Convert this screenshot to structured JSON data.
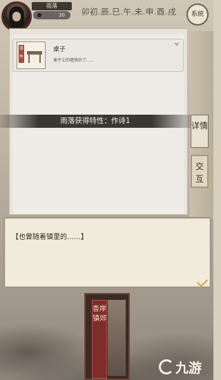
{
  "player": {
    "name": "雨落",
    "level": "20"
  },
  "time_bar": {
    "text": "卯初.辰.巳.午.未.申.酉.戌"
  },
  "system_button": {
    "label": "系统"
  },
  "event": {
    "icon_seal": "事件",
    "title": "桌子",
    "description": "桌子上的墙快好了……"
  },
  "banner": {
    "text": "雨落获得特性：作诗1"
  },
  "tabs": [
    {
      "label": "详情"
    },
    {
      "label": "交互"
    }
  ],
  "dialog": {
    "text": "【也曾随着镇里的……】"
  },
  "book": {
    "spine": "杏岸镇郊"
  },
  "watermark": {
    "text": "九游"
  },
  "colors": {
    "accent": "#3b3733",
    "dialog_bg": "#f1ebdc",
    "seal_red": "#a54a3c",
    "check": "#d1a43d"
  }
}
